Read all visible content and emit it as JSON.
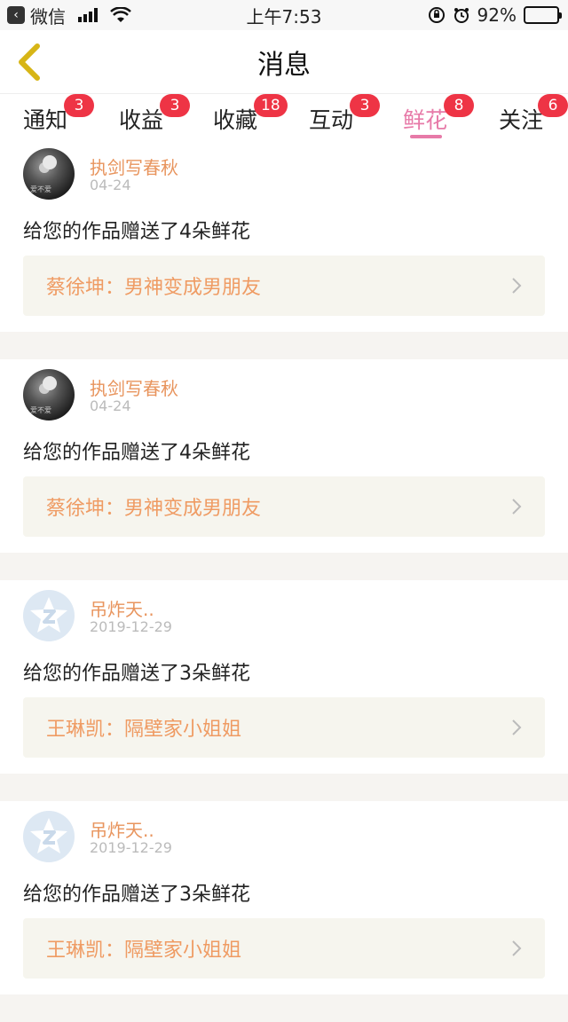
{
  "status_bar": {
    "back_app": "微信",
    "time": "上午7:53",
    "battery": "92%",
    "battery_level": 0.92
  },
  "nav": {
    "title": "消息"
  },
  "tabs": [
    {
      "label": "通知",
      "badge": "3"
    },
    {
      "label": "收益",
      "badge": "3"
    },
    {
      "label": "收藏",
      "badge": "18"
    },
    {
      "label": "互动",
      "badge": "3"
    },
    {
      "label": "鲜花",
      "badge": "8",
      "active": true
    },
    {
      "label": "关注",
      "badge": "6"
    }
  ],
  "avatar_text": "爱不爱",
  "items": [
    {
      "user": "执剑写春秋",
      "date": "04-24",
      "message": "给您的作品赠送了4朵鲜花",
      "work": "蔡徐坤：男神变成男朋友",
      "avatar": "photo"
    },
    {
      "user": "执剑写春秋",
      "date": "04-24",
      "message": "给您的作品赠送了4朵鲜花",
      "work": "蔡徐坤：男神变成男朋友",
      "avatar": "photo"
    },
    {
      "user": "吊炸天..",
      "date": "2019-12-29",
      "message": "给您的作品赠送了3朵鲜花",
      "work": "王琳凯：隔壁家小姐姐",
      "avatar": "default"
    },
    {
      "user": "吊炸天..",
      "date": "2019-12-29",
      "message": "给您的作品赠送了3朵鲜花",
      "work": "王琳凯：隔壁家小姐姐",
      "avatar": "default"
    }
  ]
}
